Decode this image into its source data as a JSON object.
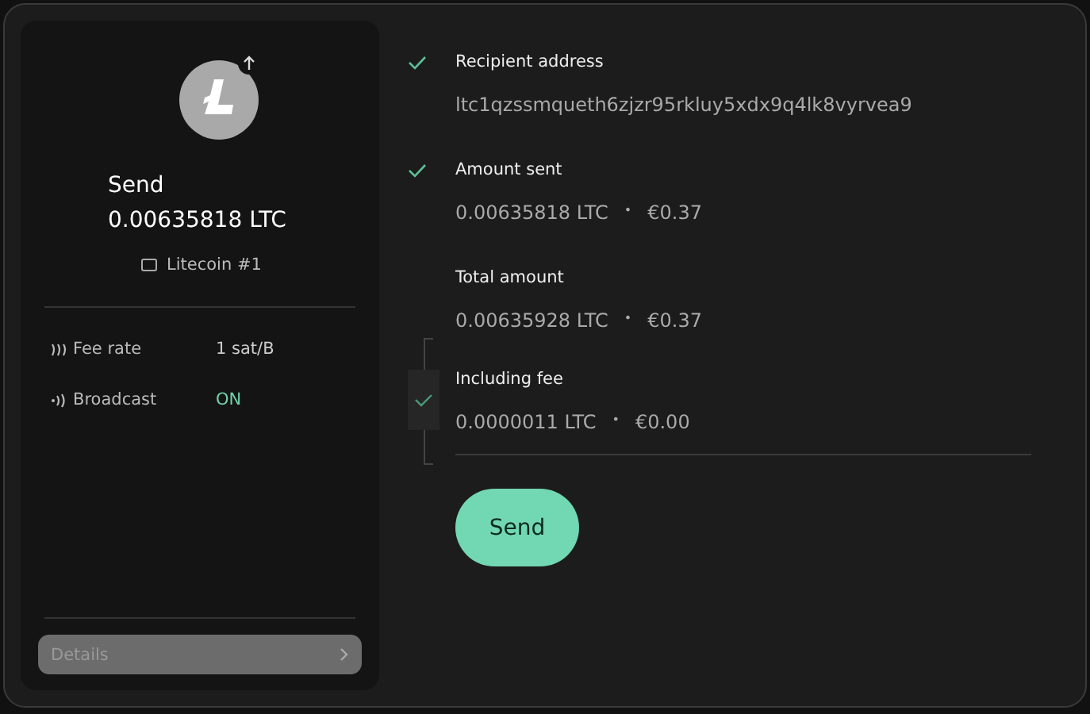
{
  "summary": {
    "title": "Send",
    "amount": "0.00635818 LTC",
    "account": "Litecoin #1"
  },
  "details": [
    {
      "kind": "fee",
      "label": "Fee rate",
      "value": "1 sat/B"
    },
    {
      "kind": "broadcast",
      "label": "Broadcast",
      "value": "ON"
    }
  ],
  "details_button": {
    "label": "Details",
    "disabled": true
  },
  "steps": [
    {
      "label": "Recipient address",
      "checked": true,
      "value": "ltc1qzssmqueth6zjzr95rkluy5xdx9q4lk8vyrvea9"
    },
    {
      "label": "Amount sent",
      "checked": true,
      "amount": "0.00635818 LTC",
      "separator": "•",
      "fiat": "€0.37"
    }
  ],
  "total": {
    "checked": true,
    "items": [
      {
        "label": "Total amount",
        "amount": "0.00635928 LTC",
        "separator": "•",
        "fiat": "€0.37"
      },
      {
        "label": "Including fee",
        "amount": "0.0000011 LTC",
        "separator": "•",
        "fiat": "€0.00"
      }
    ]
  },
  "send_button": {
    "label": "Send"
  }
}
